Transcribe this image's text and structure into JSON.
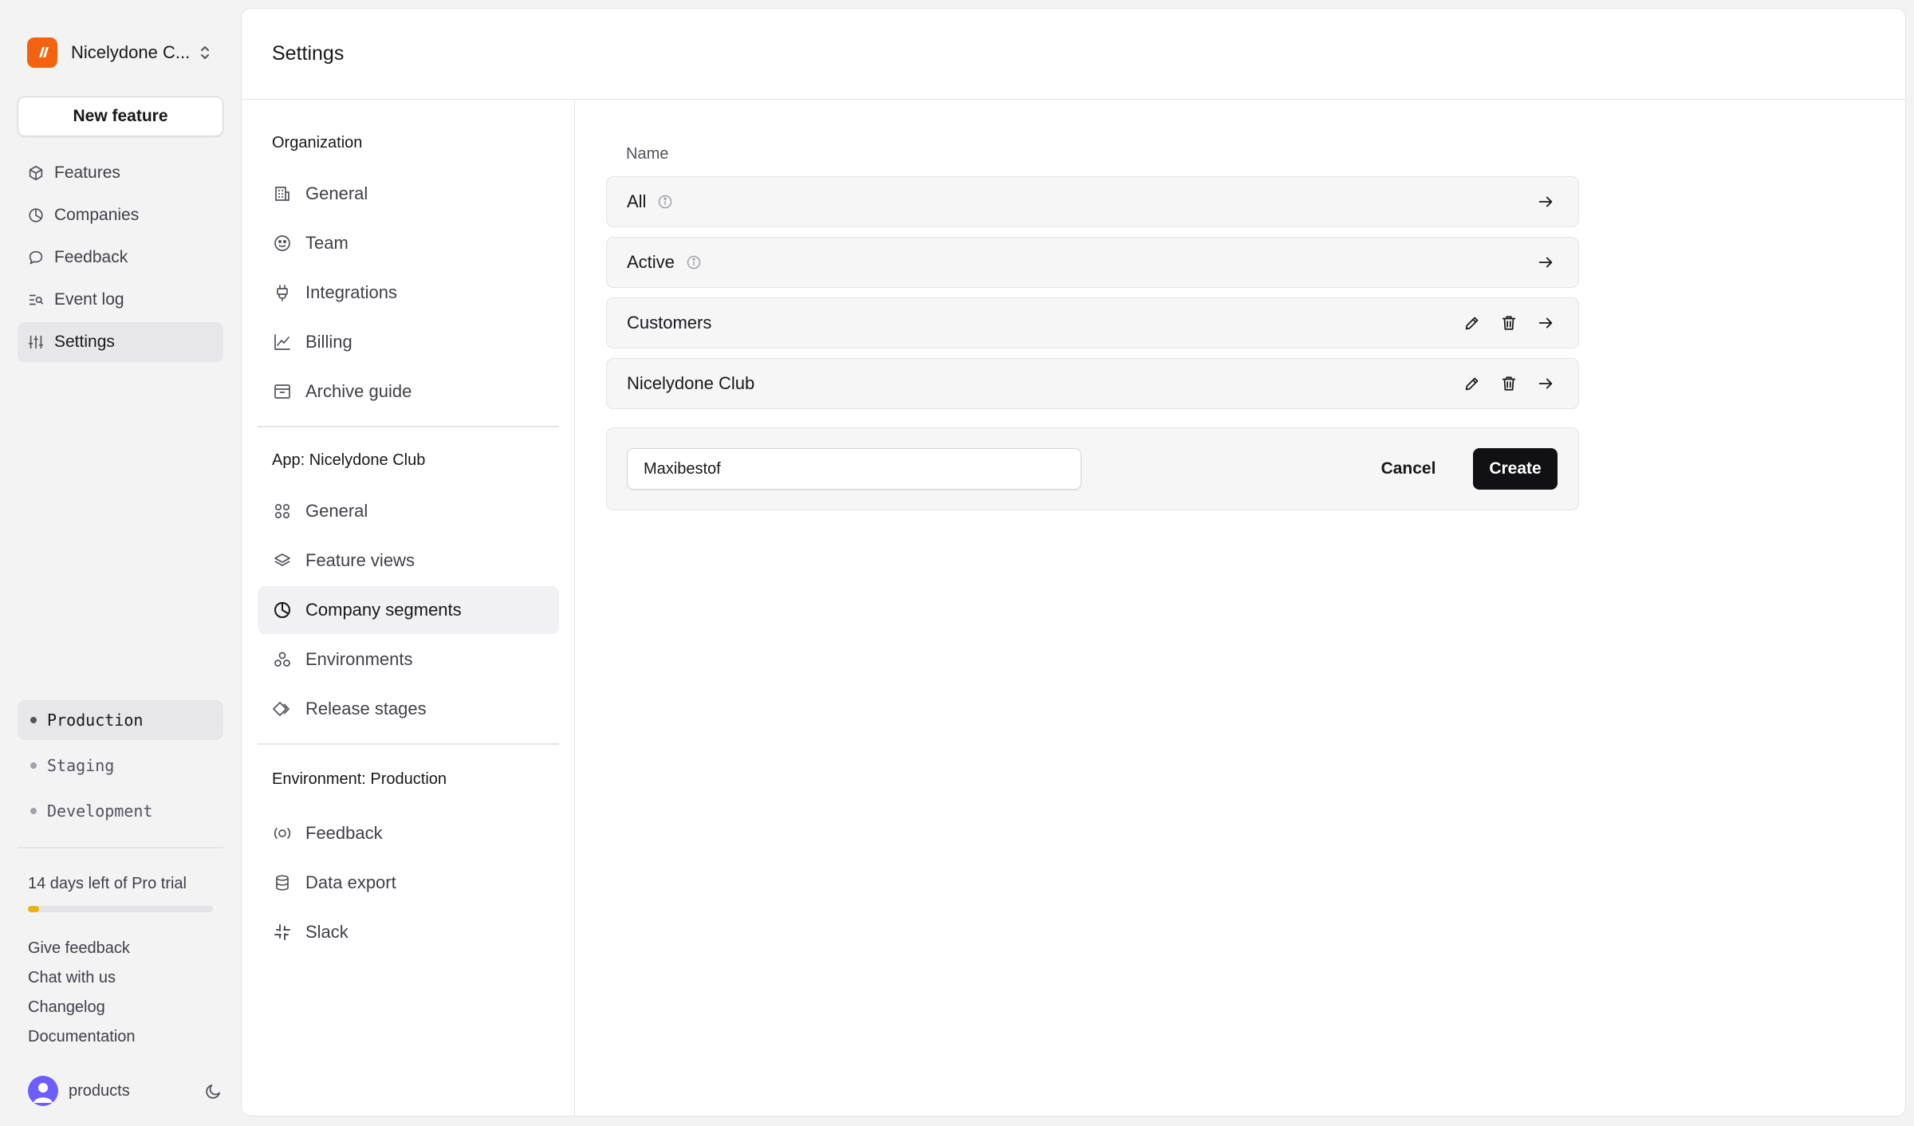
{
  "org": {
    "name": "Nicelydone C...",
    "logo_color": "#f2620f"
  },
  "new_feature_label": "New feature",
  "nav": {
    "items": [
      {
        "label": "Features",
        "icon": "cube-icon"
      },
      {
        "label": "Companies",
        "icon": "pie-chart-icon"
      },
      {
        "label": "Feedback",
        "icon": "chat-bubble-icon"
      },
      {
        "label": "Event log",
        "icon": "list-search-icon"
      },
      {
        "label": "Settings",
        "icon": "sliders-icon",
        "active": true
      }
    ]
  },
  "environments": [
    {
      "label": "Production",
      "active": true
    },
    {
      "label": "Staging"
    },
    {
      "label": "Development"
    }
  ],
  "trial": {
    "text": "14 days left of Pro trial",
    "progress": 0.06,
    "color": "#eab308"
  },
  "footer_links": [
    "Give feedback",
    "Chat with us",
    "Changelog",
    "Documentation"
  ],
  "user": {
    "name": "products",
    "avatar_color": "#6d5dfc"
  },
  "page": {
    "title": "Settings"
  },
  "settings_nav": {
    "organization": {
      "label": "Organization",
      "items": [
        {
          "label": "General",
          "icon": "building-icon"
        },
        {
          "label": "Team",
          "icon": "face-icon"
        },
        {
          "label": "Integrations",
          "icon": "plug-icon"
        },
        {
          "label": "Billing",
          "icon": "chart-line-icon"
        },
        {
          "label": "Archive guide",
          "icon": "archive-icon"
        }
      ]
    },
    "app": {
      "label": "App: Nicelydone Club",
      "items": [
        {
          "label": "General",
          "icon": "grid-circles-icon"
        },
        {
          "label": "Feature views",
          "icon": "layers-icon"
        },
        {
          "label": "Company segments",
          "icon": "pie-chart-icon",
          "active": true
        },
        {
          "label": "Environments",
          "icon": "circles-icon"
        },
        {
          "label": "Release stages",
          "icon": "diamonds-icon"
        }
      ]
    },
    "environment": {
      "label": "Environment: Production",
      "items": [
        {
          "label": "Feedback",
          "icon": "broadcast-icon"
        },
        {
          "label": "Data export",
          "icon": "database-icon"
        },
        {
          "label": "Slack",
          "icon": "slack-icon"
        }
      ]
    }
  },
  "segments": {
    "column_header": "Name",
    "rows": [
      {
        "name": "All",
        "info": true,
        "editable": false
      },
      {
        "name": "Active",
        "info": true,
        "editable": false
      },
      {
        "name": "Customers",
        "info": false,
        "editable": true
      },
      {
        "name": "Nicelydone Club",
        "info": false,
        "editable": true
      }
    ],
    "new_segment": {
      "value": "Maxibestof",
      "cancel_label": "Cancel",
      "create_label": "Create"
    }
  }
}
